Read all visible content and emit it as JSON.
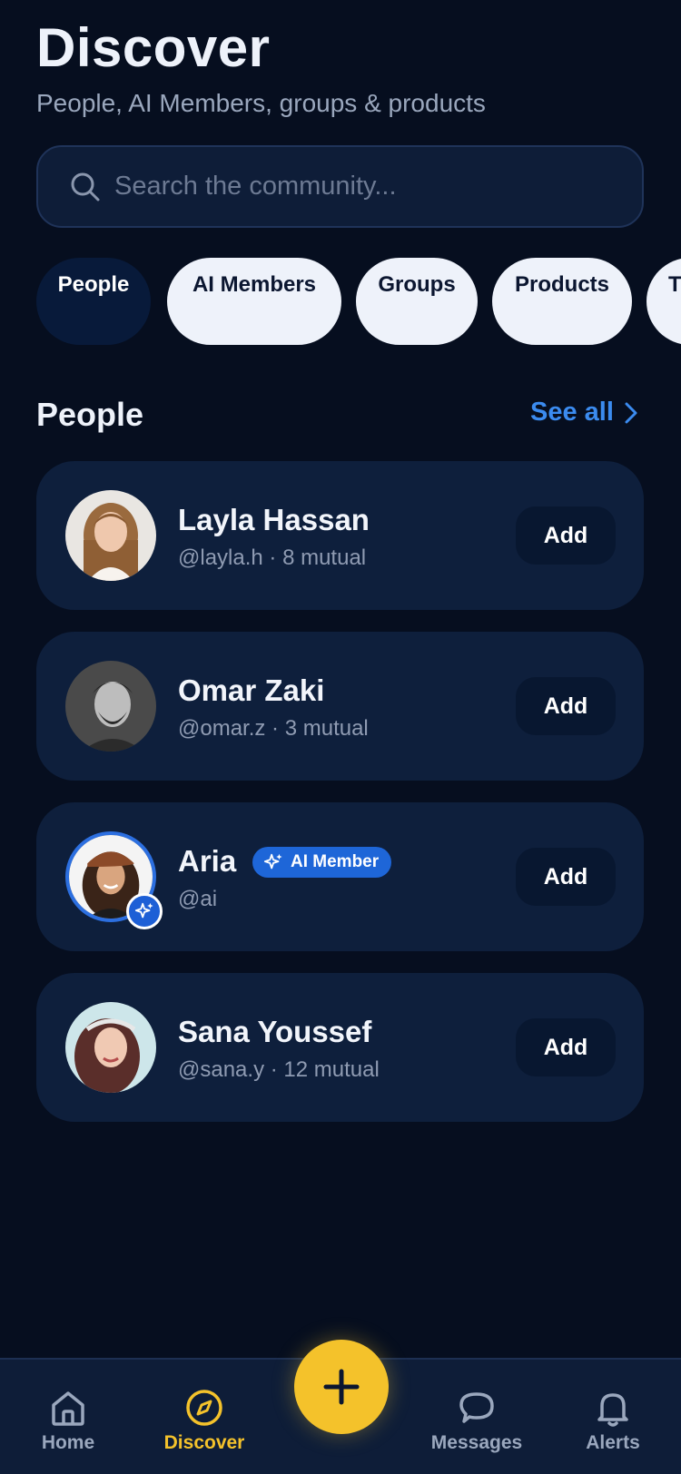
{
  "header": {
    "title": "Discover",
    "subtitle": "People, AI Members, groups & products"
  },
  "search": {
    "placeholder": "Search the community...",
    "value": ""
  },
  "filters": [
    {
      "label": "People",
      "active": true
    },
    {
      "label": "AI Members",
      "active": false
    },
    {
      "label": "Groups",
      "active": false
    },
    {
      "label": "Products",
      "active": false
    },
    {
      "label": "T",
      "active": false
    }
  ],
  "section": {
    "title": "People",
    "see_all": "See all"
  },
  "people": [
    {
      "name": "Layla Hassan",
      "handle": "@layla.h · 8 mutual",
      "action": "Add",
      "ai": false
    },
    {
      "name": "Omar Zaki",
      "handle": "@omar.z · 3 mutual",
      "action": "Add",
      "ai": false
    },
    {
      "name": "Aria",
      "handle": "@ai",
      "action": "Add",
      "ai": true,
      "badge": "AI Member"
    },
    {
      "name": "Sana Youssef",
      "handle": "@sana.y · 12 mutual",
      "action": "Add",
      "ai": false
    }
  ],
  "tabbar": {
    "items": [
      {
        "label": "Home",
        "icon": "home-icon",
        "active": false
      },
      {
        "label": "Discover",
        "icon": "compass-icon",
        "active": true
      },
      {
        "label": "Messages",
        "icon": "chat-bubble-icon",
        "active": false
      },
      {
        "label": "Alerts",
        "icon": "bell-icon",
        "active": false
      }
    ],
    "fab_icon": "plus-icon"
  },
  "colors": {
    "background": "#060e1f",
    "card": "#0e1f3c",
    "accent_blue": "#3b8bef",
    "accent_yellow": "#f4c22b",
    "ai_badge": "#1e66d8"
  }
}
